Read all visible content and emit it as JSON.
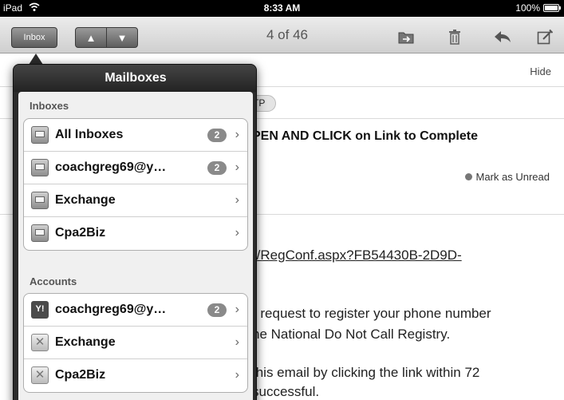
{
  "status_bar": {
    "device": "iPad",
    "time": "8:33 AM",
    "battery": "100%"
  },
  "toolbar": {
    "inbox_label": "Inbox",
    "prev_icon": "▲",
    "next_icon": "▼",
    "message_count": "4 of 46"
  },
  "message": {
    "hide_label": "Hide",
    "recipient_fragment": "TP",
    "subject": "PEN AND CLICK on Link to Complete",
    "mark_unread": "Mark as Unread",
    "link_text": "r/RegConf.aspx?FB54430B-2D9D-",
    "body_line1": "r request to register your phone number",
    "body_line2": "he National Do Not Call Registry.",
    "body_line3": "this email by clicking the link within 72",
    "body_line4": "successful."
  },
  "mailboxes": {
    "title": "Mailboxes",
    "inboxes_label": "Inboxes",
    "inboxes": [
      {
        "label": "All Inboxes",
        "badge": "2",
        "icon": "tray-icon"
      },
      {
        "label": "coachgreg69@y…",
        "badge": "2",
        "icon": "tray-icon"
      },
      {
        "label": "Exchange",
        "badge": "",
        "icon": "tray-icon"
      },
      {
        "label": "Cpa2Biz",
        "badge": "",
        "icon": "tray-icon"
      }
    ],
    "accounts_label": "Accounts",
    "accounts": [
      {
        "label": "coachgreg69@y…",
        "badge": "2",
        "icon": "yahoo-icon"
      },
      {
        "label": "Exchange",
        "badge": "",
        "icon": "exchange-icon"
      },
      {
        "label": "Cpa2Biz",
        "badge": "",
        "icon": "exchange-icon"
      }
    ]
  }
}
